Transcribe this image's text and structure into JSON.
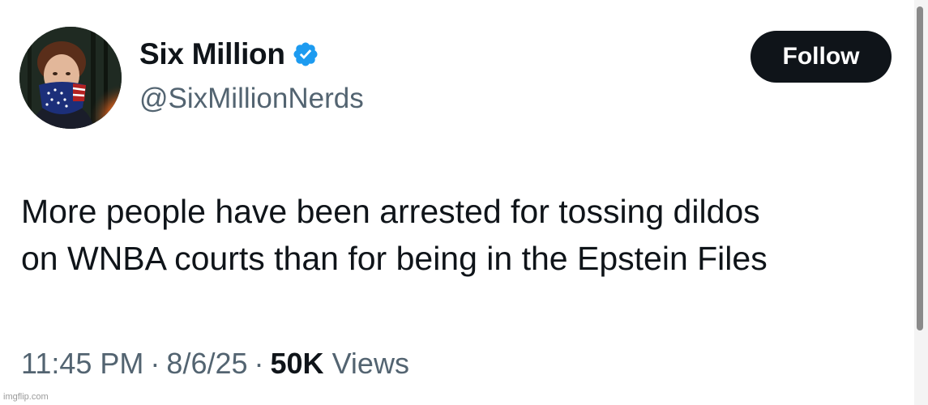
{
  "author": {
    "display_name": "Six Million",
    "handle": "@SixMillionNerds",
    "verified": true,
    "avatar_icon": "masked-person-avatar"
  },
  "actions": {
    "follow_label": "Follow"
  },
  "tweet": {
    "text_lines": [
      "More people have been arrested for tossing dildos",
      "on WNBA courts than for being in the Epstein Files"
    ],
    "time": "11:45 PM",
    "date": "8/6/25",
    "views_count": "50K",
    "views_label": "Views",
    "separator": "·"
  },
  "watermark": "imgflip.com",
  "colors": {
    "text_primary": "#0f1419",
    "text_secondary": "#536471",
    "verified_blue": "#1d9bf0",
    "follow_bg": "#0f1419"
  }
}
